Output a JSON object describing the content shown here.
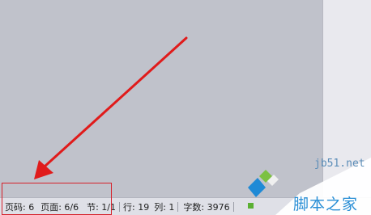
{
  "status_bar": {
    "page_code": "页码: 6",
    "page": "页面: 6/6",
    "section": "节: 1/1",
    "line": "行: 19",
    "column": "列: 1",
    "word_count": "字数: 3976"
  },
  "watermark": {
    "site": "jb51.net",
    "name": "脚本之家"
  },
  "colors": {
    "doc_background": "#c0c2cb",
    "highlight": "#d6202a",
    "arrow": "#e01b1b",
    "logo_blue": "#1f8ad6",
    "logo_green": "#7cc142"
  }
}
